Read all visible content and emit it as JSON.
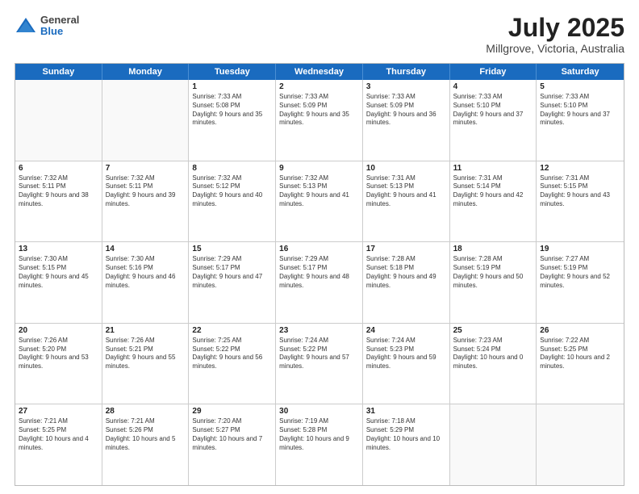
{
  "header": {
    "logo": {
      "general": "General",
      "blue": "Blue"
    },
    "title": "July 2025",
    "location": "Millgrove, Victoria, Australia"
  },
  "weekdays": [
    "Sunday",
    "Monday",
    "Tuesday",
    "Wednesday",
    "Thursday",
    "Friday",
    "Saturday"
  ],
  "weeks": [
    [
      {
        "day": "",
        "empty": true
      },
      {
        "day": "",
        "empty": true
      },
      {
        "day": "1",
        "sunrise": "Sunrise: 7:33 AM",
        "sunset": "Sunset: 5:08 PM",
        "daylight": "Daylight: 9 hours and 35 minutes."
      },
      {
        "day": "2",
        "sunrise": "Sunrise: 7:33 AM",
        "sunset": "Sunset: 5:09 PM",
        "daylight": "Daylight: 9 hours and 35 minutes."
      },
      {
        "day": "3",
        "sunrise": "Sunrise: 7:33 AM",
        "sunset": "Sunset: 5:09 PM",
        "daylight": "Daylight: 9 hours and 36 minutes."
      },
      {
        "day": "4",
        "sunrise": "Sunrise: 7:33 AM",
        "sunset": "Sunset: 5:10 PM",
        "daylight": "Daylight: 9 hours and 37 minutes."
      },
      {
        "day": "5",
        "sunrise": "Sunrise: 7:33 AM",
        "sunset": "Sunset: 5:10 PM",
        "daylight": "Daylight: 9 hours and 37 minutes."
      }
    ],
    [
      {
        "day": "6",
        "sunrise": "Sunrise: 7:32 AM",
        "sunset": "Sunset: 5:11 PM",
        "daylight": "Daylight: 9 hours and 38 minutes."
      },
      {
        "day": "7",
        "sunrise": "Sunrise: 7:32 AM",
        "sunset": "Sunset: 5:11 PM",
        "daylight": "Daylight: 9 hours and 39 minutes."
      },
      {
        "day": "8",
        "sunrise": "Sunrise: 7:32 AM",
        "sunset": "Sunset: 5:12 PM",
        "daylight": "Daylight: 9 hours and 40 minutes."
      },
      {
        "day": "9",
        "sunrise": "Sunrise: 7:32 AM",
        "sunset": "Sunset: 5:13 PM",
        "daylight": "Daylight: 9 hours and 41 minutes."
      },
      {
        "day": "10",
        "sunrise": "Sunrise: 7:31 AM",
        "sunset": "Sunset: 5:13 PM",
        "daylight": "Daylight: 9 hours and 41 minutes."
      },
      {
        "day": "11",
        "sunrise": "Sunrise: 7:31 AM",
        "sunset": "Sunset: 5:14 PM",
        "daylight": "Daylight: 9 hours and 42 minutes."
      },
      {
        "day": "12",
        "sunrise": "Sunrise: 7:31 AM",
        "sunset": "Sunset: 5:15 PM",
        "daylight": "Daylight: 9 hours and 43 minutes."
      }
    ],
    [
      {
        "day": "13",
        "sunrise": "Sunrise: 7:30 AM",
        "sunset": "Sunset: 5:15 PM",
        "daylight": "Daylight: 9 hours and 45 minutes."
      },
      {
        "day": "14",
        "sunrise": "Sunrise: 7:30 AM",
        "sunset": "Sunset: 5:16 PM",
        "daylight": "Daylight: 9 hours and 46 minutes."
      },
      {
        "day": "15",
        "sunrise": "Sunrise: 7:29 AM",
        "sunset": "Sunset: 5:17 PM",
        "daylight": "Daylight: 9 hours and 47 minutes."
      },
      {
        "day": "16",
        "sunrise": "Sunrise: 7:29 AM",
        "sunset": "Sunset: 5:17 PM",
        "daylight": "Daylight: 9 hours and 48 minutes."
      },
      {
        "day": "17",
        "sunrise": "Sunrise: 7:28 AM",
        "sunset": "Sunset: 5:18 PM",
        "daylight": "Daylight: 9 hours and 49 minutes."
      },
      {
        "day": "18",
        "sunrise": "Sunrise: 7:28 AM",
        "sunset": "Sunset: 5:19 PM",
        "daylight": "Daylight: 9 hours and 50 minutes."
      },
      {
        "day": "19",
        "sunrise": "Sunrise: 7:27 AM",
        "sunset": "Sunset: 5:19 PM",
        "daylight": "Daylight: 9 hours and 52 minutes."
      }
    ],
    [
      {
        "day": "20",
        "sunrise": "Sunrise: 7:26 AM",
        "sunset": "Sunset: 5:20 PM",
        "daylight": "Daylight: 9 hours and 53 minutes."
      },
      {
        "day": "21",
        "sunrise": "Sunrise: 7:26 AM",
        "sunset": "Sunset: 5:21 PM",
        "daylight": "Daylight: 9 hours and 55 minutes."
      },
      {
        "day": "22",
        "sunrise": "Sunrise: 7:25 AM",
        "sunset": "Sunset: 5:22 PM",
        "daylight": "Daylight: 9 hours and 56 minutes."
      },
      {
        "day": "23",
        "sunrise": "Sunrise: 7:24 AM",
        "sunset": "Sunset: 5:22 PM",
        "daylight": "Daylight: 9 hours and 57 minutes."
      },
      {
        "day": "24",
        "sunrise": "Sunrise: 7:24 AM",
        "sunset": "Sunset: 5:23 PM",
        "daylight": "Daylight: 9 hours and 59 minutes."
      },
      {
        "day": "25",
        "sunrise": "Sunrise: 7:23 AM",
        "sunset": "Sunset: 5:24 PM",
        "daylight": "Daylight: 10 hours and 0 minutes."
      },
      {
        "day": "26",
        "sunrise": "Sunrise: 7:22 AM",
        "sunset": "Sunset: 5:25 PM",
        "daylight": "Daylight: 10 hours and 2 minutes."
      }
    ],
    [
      {
        "day": "27",
        "sunrise": "Sunrise: 7:21 AM",
        "sunset": "Sunset: 5:25 PM",
        "daylight": "Daylight: 10 hours and 4 minutes."
      },
      {
        "day": "28",
        "sunrise": "Sunrise: 7:21 AM",
        "sunset": "Sunset: 5:26 PM",
        "daylight": "Daylight: 10 hours and 5 minutes."
      },
      {
        "day": "29",
        "sunrise": "Sunrise: 7:20 AM",
        "sunset": "Sunset: 5:27 PM",
        "daylight": "Daylight: 10 hours and 7 minutes."
      },
      {
        "day": "30",
        "sunrise": "Sunrise: 7:19 AM",
        "sunset": "Sunset: 5:28 PM",
        "daylight": "Daylight: 10 hours and 9 minutes."
      },
      {
        "day": "31",
        "sunrise": "Sunrise: 7:18 AM",
        "sunset": "Sunset: 5:29 PM",
        "daylight": "Daylight: 10 hours and 10 minutes."
      },
      {
        "day": "",
        "empty": true
      },
      {
        "day": "",
        "empty": true
      }
    ]
  ]
}
